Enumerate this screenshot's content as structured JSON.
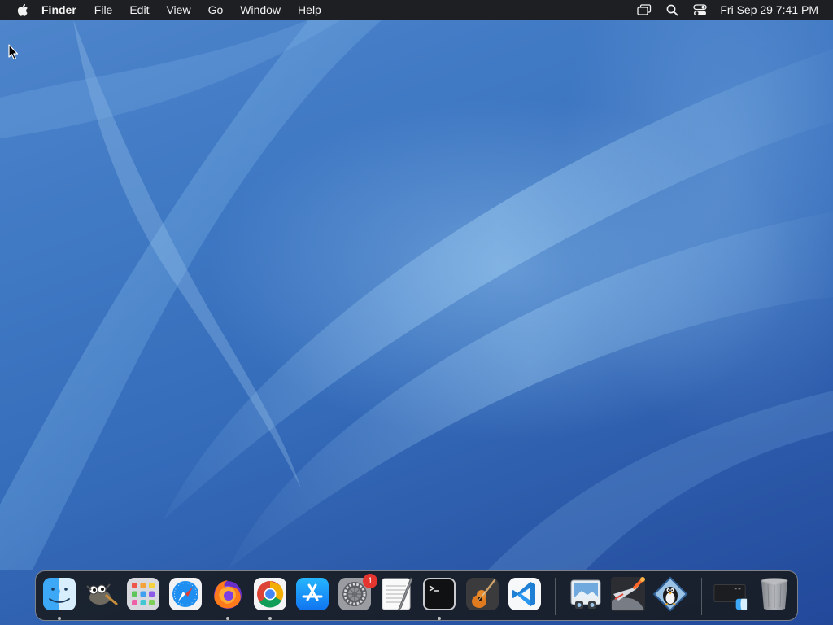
{
  "menubar": {
    "app_name": "Finder",
    "menus": [
      "File",
      "Edit",
      "View",
      "Go",
      "Window",
      "Help"
    ],
    "status_icons": [
      "screen-mirroring-icon",
      "spotlight-search-icon",
      "control-center-icon"
    ],
    "clock": "Fri Sep 29  7:41 PM"
  },
  "colors": {
    "menubar_bg": "#1d1f22",
    "desktop_primary": "#356cba",
    "badge_red": "#e5352f"
  },
  "dock": {
    "items": [
      {
        "name": "Finder",
        "icon": "finder-icon",
        "running": true
      },
      {
        "name": "GIMP",
        "icon": "gimp-icon",
        "running": false
      },
      {
        "name": "Launchpad",
        "icon": "launchpad-icon",
        "running": false
      },
      {
        "name": "Safari",
        "icon": "safari-icon",
        "running": false
      },
      {
        "name": "Firefox",
        "icon": "firefox-icon",
        "running": true
      },
      {
        "name": "Google Chrome",
        "icon": "chrome-icon",
        "running": true
      },
      {
        "name": "App Store",
        "icon": "app-store-icon",
        "running": false
      },
      {
        "name": "System Settings",
        "icon": "system-settings-icon",
        "running": false,
        "badge": "1"
      },
      {
        "name": "TextEdit",
        "icon": "textedit-icon",
        "running": false
      },
      {
        "name": "Terminal",
        "icon": "terminal-icon",
        "running": true
      },
      {
        "name": "GarageBand",
        "icon": "garageband-icon",
        "running": false
      },
      {
        "name": "Visual Studio Code",
        "icon": "vscode-icon",
        "running": false
      },
      {
        "name": "Preview",
        "icon": "preview-icon",
        "running": false
      },
      {
        "name": "Rocket",
        "icon": "rocket-icon",
        "running": false
      },
      {
        "name": "SuperTux",
        "icon": "tux-icon",
        "running": false
      },
      {
        "name": "Downloads",
        "icon": "downloads-stack-icon",
        "running": false
      },
      {
        "name": "Trash",
        "icon": "trash-icon",
        "running": false
      }
    ]
  }
}
